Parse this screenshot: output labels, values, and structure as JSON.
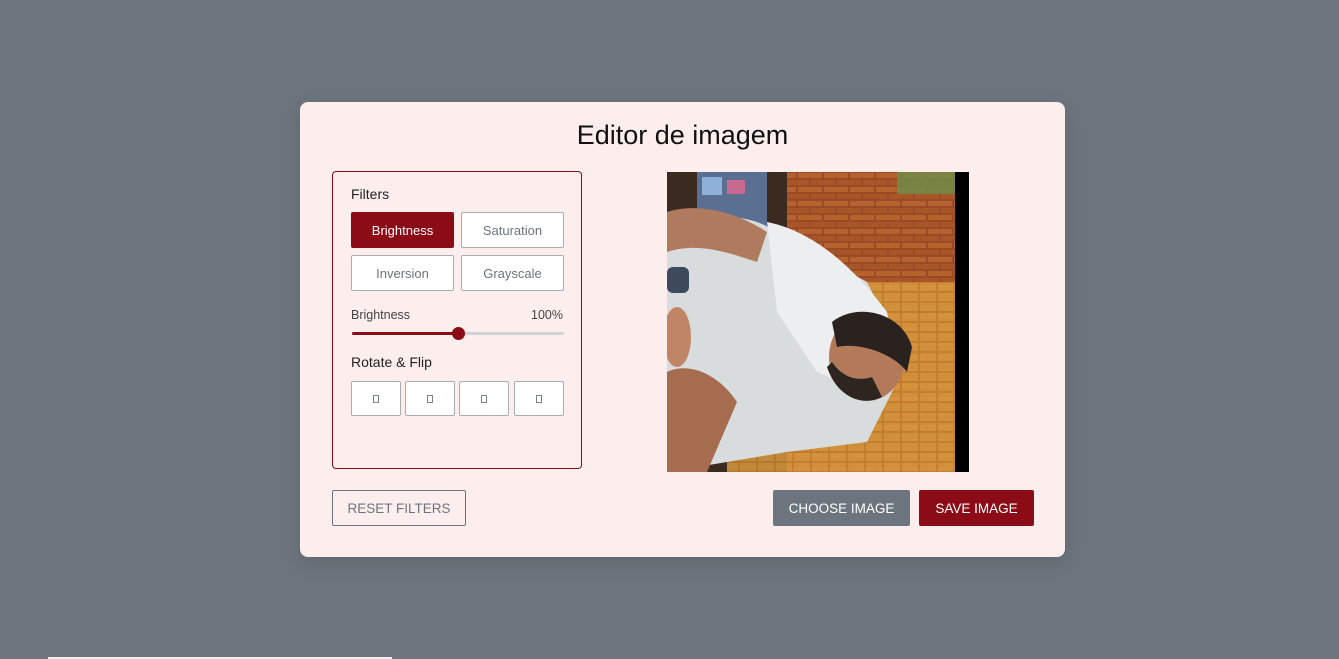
{
  "app": {
    "title": "Editor de imagem"
  },
  "filters": {
    "heading": "Filters",
    "options": [
      {
        "label": "Brightness",
        "active": true
      },
      {
        "label": "Saturation",
        "active": false
      },
      {
        "label": "Inversion",
        "active": false
      },
      {
        "label": "Grayscale",
        "active": false
      }
    ]
  },
  "slider": {
    "name": "Brightness",
    "value_text": "100%",
    "value_fraction": 0.5
  },
  "rotate": {
    "heading": "Rotate & Flip",
    "buttons": [
      {
        "icon": "rotate-left-icon"
      },
      {
        "icon": "rotate-right-icon"
      },
      {
        "icon": "flip-horizontal-icon"
      },
      {
        "icon": "flip-vertical-icon"
      }
    ]
  },
  "actions": {
    "reset": "Reset Filters",
    "choose": "Choose Image",
    "save": "Save Image"
  },
  "colors": {
    "accent": "#8b0b16",
    "secondary": "#6c757d",
    "card_bg": "#fdeeee"
  }
}
